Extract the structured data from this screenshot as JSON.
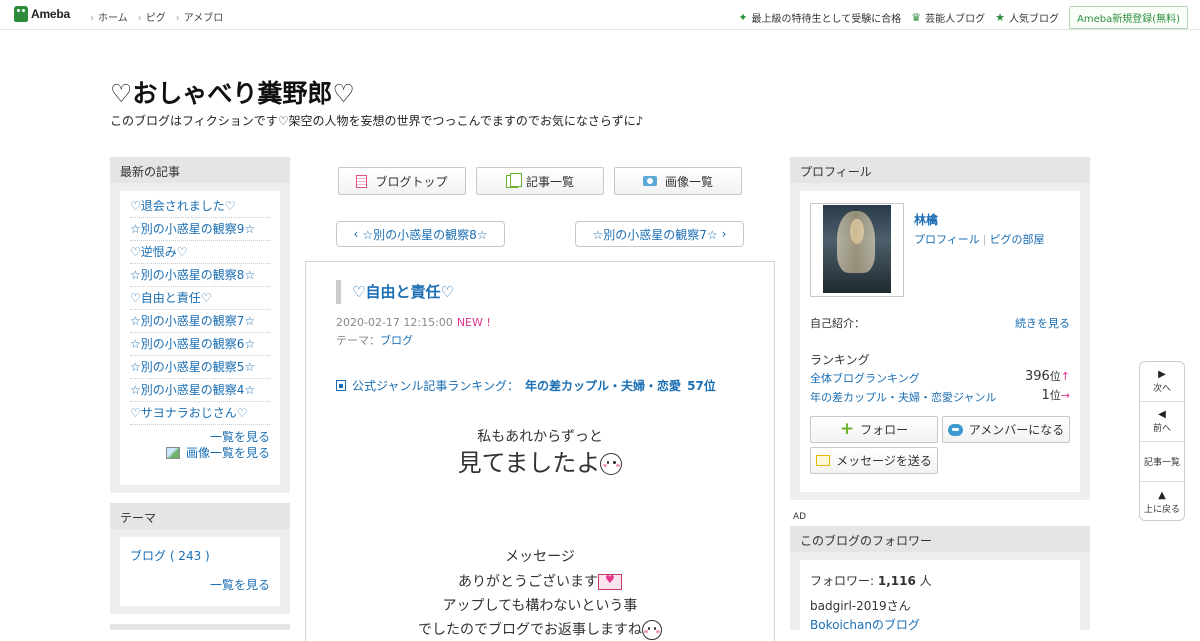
{
  "topbar": {
    "logo_text": "Ameba",
    "nav": [
      "ホーム",
      "ピグ",
      "アメブロ"
    ],
    "right_links": [
      {
        "icon": "star-icon",
        "label": "最上級の特待生として受験に合格"
      },
      {
        "icon": "crown-icon",
        "label": "芸能人ブログ"
      },
      {
        "icon": "star-icon",
        "label": "人気ブログ"
      }
    ],
    "register_label": "Ameba新規登録(無料)"
  },
  "blog": {
    "title": "♡おしゃべり糞野郎♡",
    "description": "このブログはフィクションです♡架空の人物を妄想の世界でつっこんでますのでお気になさらずに♪"
  },
  "left": {
    "recent_heading": "最新の記事",
    "recent_items": [
      "♡退会されました♡",
      "☆別の小惑星の観察9☆",
      "♡逆恨み♡",
      "☆別の小惑星の観察8☆",
      "♡自由と責任♡",
      "☆別の小惑星の観察7☆",
      "☆別の小惑星の観察6☆",
      "☆別の小惑星の観察5☆",
      "☆別の小惑星の観察4☆",
      "♡サヨナラおじさん♡"
    ],
    "see_all": "一覧を見る",
    "see_images": "画像一覧を見る",
    "theme_heading": "テーマ",
    "theme_item": "ブログ ( 243 )",
    "theme_see_all": "一覧を見る"
  },
  "center": {
    "tabs": [
      "ブログトップ",
      "記事一覧",
      "画像一覧"
    ],
    "prev_label": "☆別の小惑星の観察8☆",
    "next_label": "☆別の小惑星の観察7☆",
    "article": {
      "title": "♡自由と責任♡",
      "date": "2020-02-17 12:15:00",
      "new_badge": "NEW !",
      "theme_label": "テーマ：",
      "theme_value": "ブログ",
      "ranking_label": "公式ジャンル記事ランキング：",
      "ranking_genre": "年の差カップル・夫婦・恋愛",
      "ranking_rank": "57位",
      "line1": "私もあれからずっと",
      "line2": "見てましたよ",
      "line3": "メッセージ",
      "line4": "ありがとうございます",
      "line5": "アップしても構わないという事",
      "line6": "でしたのでブログでお返事しますね"
    }
  },
  "right": {
    "profile_heading": "プロフィール",
    "name": "林檎",
    "profile_link": "プロフィール",
    "pig_link": "ピグの部屋",
    "intro_label": "自己紹介：",
    "intro_more": "続きを見る",
    "ranking_heading": "ランキング",
    "rank_all_label": "全体ブログランキング",
    "rank_all_value": "396",
    "rank_genre_label": "年の差カップル・夫婦・恋愛ジャンル",
    "rank_genre_value": "1",
    "rank_unit": "位",
    "follow_label": "フォロー",
    "member_label": "アメンバーになる",
    "message_label": "メッセージを送る",
    "ad_label": "AD",
    "followers_heading": "このブログのフォロワー",
    "followers_label": "フォロワー:",
    "followers_count": "1,116",
    "followers_unit": "人",
    "follower_name": "badgirl-2019さん",
    "follower_blog": "Bokoichanのブログ"
  },
  "sidenav": {
    "next": "次へ",
    "prev": "前へ",
    "list": "記事一覧",
    "top": "上に戻る"
  }
}
